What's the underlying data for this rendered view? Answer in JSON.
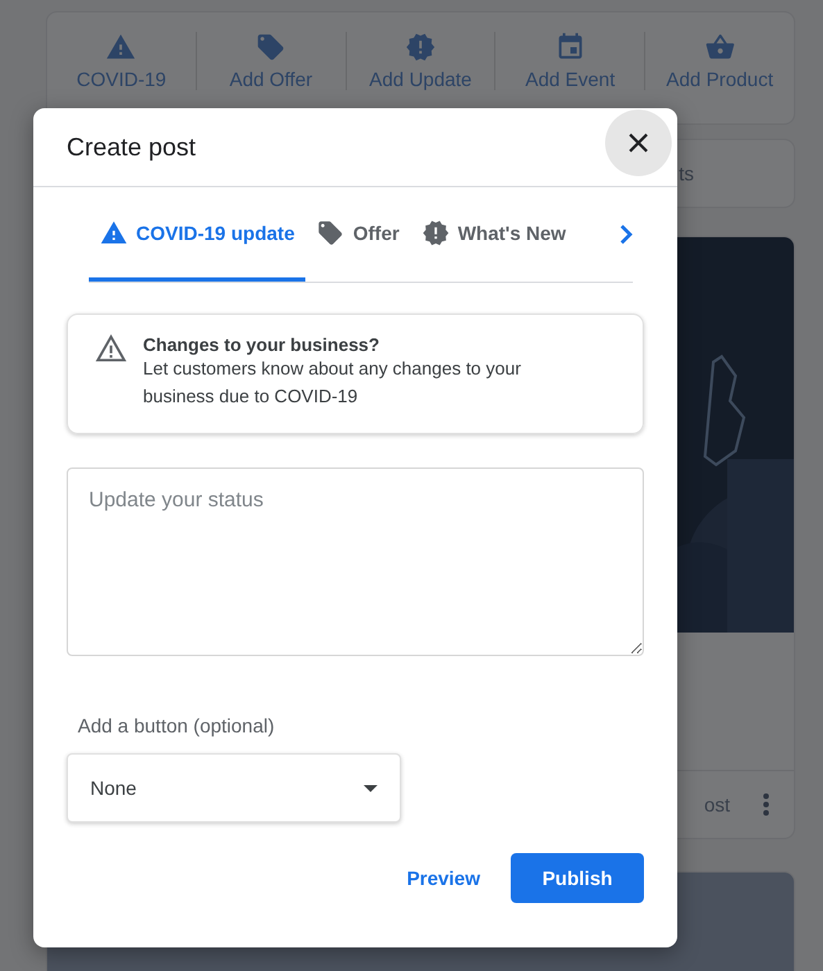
{
  "background": {
    "toolbar": [
      {
        "kind": "warning",
        "label": "COVID-19"
      },
      {
        "kind": "tag",
        "label": "Add Offer"
      },
      {
        "kind": "badge",
        "label": "Add Update"
      },
      {
        "kind": "calendar",
        "label": "Add Event"
      },
      {
        "kind": "basket",
        "label": "Add Product"
      }
    ],
    "second_card": {
      "text": "ts"
    },
    "post_card": {
      "kind": "picture",
      "footer_text": "ost"
    }
  },
  "dialog": {
    "title": "Create post",
    "tabs": [
      {
        "kind": "warning",
        "label": "COVID-19 update",
        "selected": true
      },
      {
        "kind": "tag",
        "label": "Offer",
        "selected": false
      },
      {
        "kind": "badge",
        "label": "What's New",
        "selected": false
      }
    ],
    "info": {
      "title": "Changes to your business?",
      "text": "Let customers know about any changes to your business due to COVID-19"
    },
    "status_field": {
      "placeholder": "Update your status"
    },
    "button_select": {
      "label": "Add a button (optional)",
      "value": "None"
    },
    "actions": [
      {
        "kind": "text",
        "label": "Preview"
      },
      {
        "kind": "filled",
        "label": "Publish"
      }
    ]
  }
}
